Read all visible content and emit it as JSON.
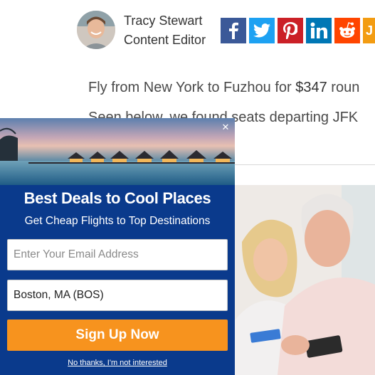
{
  "author": {
    "name": "Tracy Stewart",
    "role": "Content Editor"
  },
  "share": {
    "buttons": [
      {
        "name": "facebook",
        "icon": "facebook-icon",
        "color": "#3b5998"
      },
      {
        "name": "twitter",
        "icon": "twitter-icon",
        "color": "#1da1f2"
      },
      {
        "name": "pinterest",
        "icon": "pinterest-icon",
        "color": "#cb2027"
      },
      {
        "name": "linkedin",
        "icon": "linkedin-icon",
        "color": "#0077b5"
      },
      {
        "name": "reddit",
        "icon": "reddit-icon",
        "color": "#ff4500"
      },
      {
        "name": "partial",
        "icon": "partial-icon",
        "color": "#f39c12"
      }
    ]
  },
  "article": {
    "lead_prefix": "Fly from New York to Fuzhou for ",
    "lead_price": "$347",
    "lead_suffix": " roun",
    "second_line": "Seen below, we found seats departing JFK"
  },
  "popup": {
    "headline": "Best Deals to Cool Places",
    "subheadline": "Get Cheap Flights to Top Destinations",
    "email_placeholder": "Enter Your Email Address",
    "origin_value": "Boston, MA (BOS)",
    "cta_label": "Sign Up Now",
    "decline_label": "No thanks, I'm not interested",
    "close_label": "✕",
    "colors": {
      "background": "#0a3a8c",
      "cta": "#f7931e"
    }
  }
}
